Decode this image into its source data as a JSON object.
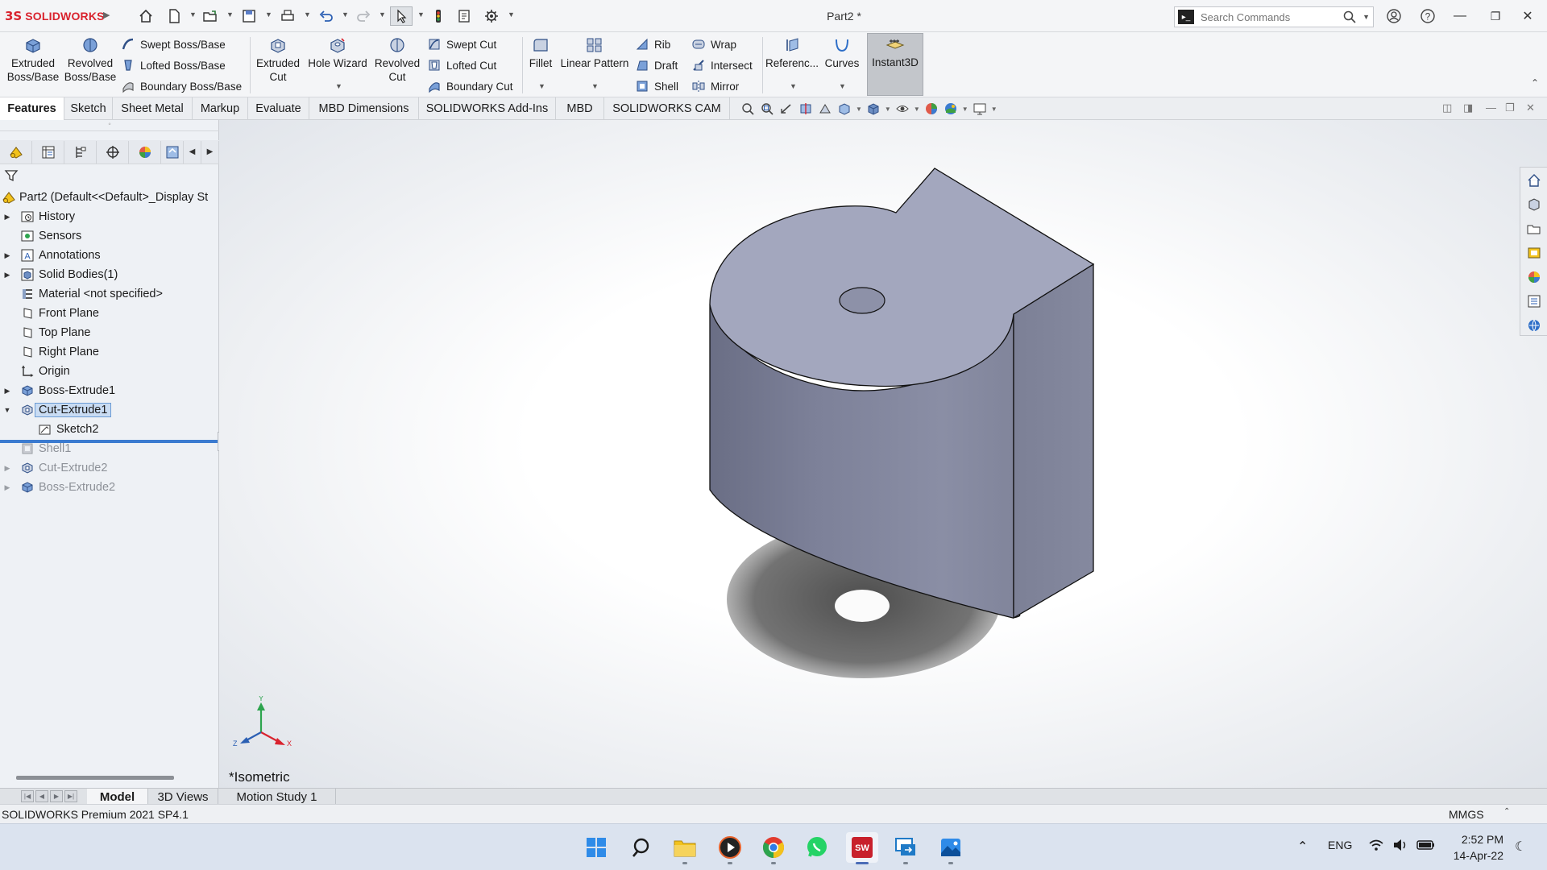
{
  "app": {
    "logo_mark": "3S",
    "logo_text": "SOLIDWORKS",
    "document_title": "Part2 *"
  },
  "search": {
    "placeholder": "Search Commands"
  },
  "ribbon": {
    "extruded_boss": [
      "Extruded",
      "Boss/Base"
    ],
    "revolved_boss": [
      "Revolved",
      "Boss/Base"
    ],
    "swept_boss": "Swept Boss/Base",
    "lofted_boss": "Lofted Boss/Base",
    "boundary_boss": "Boundary Boss/Base",
    "extruded_cut": [
      "Extruded",
      "Cut"
    ],
    "hole_wizard": "Hole Wizard",
    "revolved_cut": [
      "Revolved",
      "Cut"
    ],
    "swept_cut": "Swept Cut",
    "lofted_cut": "Lofted Cut",
    "boundary_cut": "Boundary Cut",
    "fillet": "Fillet",
    "linear_pattern": "Linear Pattern",
    "rib": "Rib",
    "draft": "Draft",
    "shell": "Shell",
    "wrap": "Wrap",
    "intersect": "Intersect",
    "mirror": "Mirror",
    "reference": "Referenc...",
    "curves": "Curves",
    "instant3d": "Instant3D"
  },
  "command_tabs": [
    "Features",
    "Sketch",
    "Sheet Metal",
    "Markup",
    "Evaluate",
    "MBD Dimensions",
    "SOLIDWORKS Add-Ins",
    "MBD",
    "SOLIDWORKS CAM"
  ],
  "tree": {
    "root": "Part2  (Default<<Default>_Display St",
    "items": [
      {
        "label": "History",
        "icon": "history-folder-icon",
        "expandable": true
      },
      {
        "label": "Sensors",
        "icon": "sensors-folder-icon",
        "expandable": false
      },
      {
        "label": "Annotations",
        "icon": "annotations-icon",
        "expandable": true
      },
      {
        "label": "Solid Bodies(1)",
        "icon": "solid-bodies-icon",
        "expandable": true
      },
      {
        "label": "Material <not specified>",
        "icon": "material-icon",
        "expandable": false
      },
      {
        "label": "Front Plane",
        "icon": "plane-icon",
        "expandable": false
      },
      {
        "label": "Top Plane",
        "icon": "plane-icon",
        "expandable": false
      },
      {
        "label": "Right Plane",
        "icon": "plane-icon",
        "expandable": false
      },
      {
        "label": "Origin",
        "icon": "origin-icon",
        "expandable": false
      },
      {
        "label": "Boss-Extrude1",
        "icon": "boss-extrude-icon",
        "expandable": true
      },
      {
        "label": "Cut-Extrude1",
        "icon": "cut-extrude-icon",
        "expandable": true,
        "expanded": true,
        "selected": true
      },
      {
        "label": "Sketch2",
        "icon": "sketch-icon",
        "expandable": false,
        "child": true
      },
      {
        "label": "Shell1",
        "icon": "shell-icon",
        "expandable": false,
        "suppressed": true
      },
      {
        "label": "Cut-Extrude2",
        "icon": "cut-extrude-icon",
        "expandable": true,
        "suppressed": true
      },
      {
        "label": "Boss-Extrude2",
        "icon": "boss-extrude-icon",
        "expandable": true,
        "suppressed": true
      }
    ]
  },
  "viewport": {
    "view_name": "*Isometric",
    "axis_x": "X",
    "axis_y": "Y",
    "axis_z": "Z"
  },
  "bottom_tabs": [
    "Model",
    "3D Views",
    "Motion Study 1"
  ],
  "status": {
    "left": "SOLIDWORKS Premium 2021 SP4.1",
    "units": "MMGS"
  },
  "taskbar": {
    "lang": "ENG",
    "time": "2:52 PM",
    "date": "14-Apr-22"
  },
  "colors": {
    "brand_red": "#d9232e",
    "selection_blue": "#3b7bd0",
    "model_top": "#a4a8bf",
    "model_side": "#7c8096"
  }
}
